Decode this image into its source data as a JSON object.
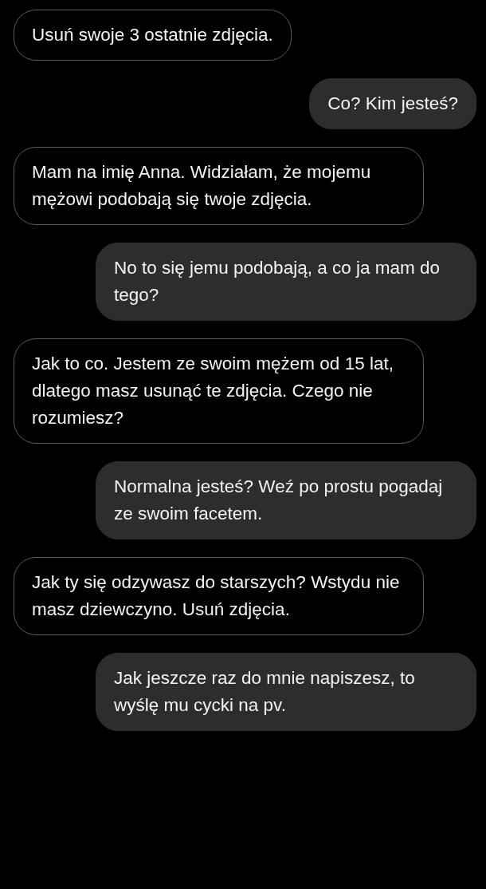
{
  "messages": [
    {
      "kind": "received",
      "text": "Usuń swoje 3 ostatnie zdjęcia."
    },
    {
      "kind": "sent",
      "text": "Co? Kim jesteś?"
    },
    {
      "kind": "received",
      "text": "Mam na imię Anna. Widziałam, że mojemu mężowi podobają się twoje zdjęcia."
    },
    {
      "kind": "sent",
      "text": "No to się jemu podobają, a co ja mam do tego?"
    },
    {
      "kind": "received",
      "text": "Jak to co. Jestem ze swoim mężem od 15 lat, dlatego masz usunąć te zdjęcia. Czego nie rozumiesz?"
    },
    {
      "kind": "sent",
      "text": "Normalna jesteś? Weź po prostu pogadaj ze swoim facetem."
    },
    {
      "kind": "received",
      "text": "Jak ty się odzywasz do starszych? Wstydu nie masz dziewczyno. Usuń zdjęcia."
    },
    {
      "kind": "sent",
      "text": "Jak jeszcze raz do mnie napiszesz, to wyślę mu cycki na pv."
    }
  ]
}
